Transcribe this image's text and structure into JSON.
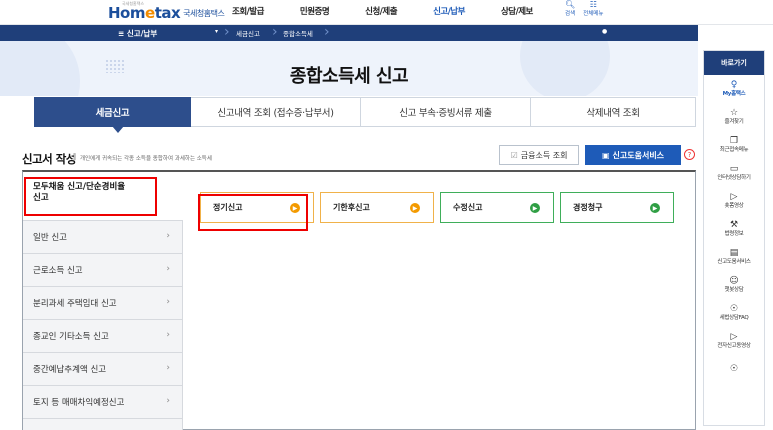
{
  "header": {
    "logo_small": "국세청홈택스",
    "logo_brand_prefix": "Hom",
    "logo_brand_e": "e",
    "logo_brand_suffix": "tax",
    "logo_nts": "국세청홈택스",
    "nav": [
      "조회/발급",
      "민원증명",
      "신청/제출",
      "신고/납부",
      "상담/제보"
    ],
    "active_nav": "신고/납부",
    "util": [
      {
        "icon": "search-icon",
        "label": "검색"
      },
      {
        "icon": "grid-menu-icon",
        "label": "전체메뉴"
      }
    ]
  },
  "subnav": {
    "menu_title": "≡  신고/납부",
    "crumb1": "세금신고",
    "crumb2": "종합소득세"
  },
  "hero": {
    "title": "종합소득세 신고"
  },
  "tabs": [
    "세금신고",
    "신고내역 조회 (접수증·납부서)",
    "신고 부속·증빙서류 제출",
    "삭제내역 조회"
  ],
  "section": {
    "title": "신고서 작성",
    "desc": "개인에게 귀속되는 각종 소득을 종합하여 과세하는 소득세",
    "btn_financial": "금융소득 조회",
    "btn_help": "신고도움서비스",
    "help_mark": "?"
  },
  "left_menu": [
    {
      "label": "모두채움 신고/단순경비율\n신고",
      "active": true
    },
    {
      "label": "일반 신고"
    },
    {
      "label": "근로소득 신고"
    },
    {
      "label": "분리과세 주택임대 신고"
    },
    {
      "label": "종교인 기타소득 신고"
    },
    {
      "label": "중간예납추계액 신고"
    },
    {
      "label": "토지 등 매매차익예정신고"
    }
  ],
  "cards": [
    {
      "label": "정기신고",
      "color": "orange"
    },
    {
      "label": "기한후신고",
      "color": "orange"
    },
    {
      "label": "수정신고",
      "color": "green"
    },
    {
      "label": "경정청구",
      "color": "green"
    }
  ],
  "right_bar": {
    "title": "바로가기",
    "items": [
      {
        "icon": "user-icon",
        "label": "My홈택스"
      },
      {
        "icon": "star-icon",
        "label": "즐겨찾기"
      },
      {
        "icon": "recent-menu-icon",
        "label": "최근접속메뉴"
      },
      {
        "icon": "monitor-icon",
        "label": "인터넷상담하기"
      },
      {
        "icon": "video-icon",
        "label": "숏폼영상"
      },
      {
        "icon": "gavel-icon",
        "label": "법령정보"
      },
      {
        "icon": "book-icon",
        "label": "신고도움서비스"
      },
      {
        "icon": "chatbot-icon",
        "label": "챗봇상담"
      },
      {
        "icon": "faq-icon",
        "label": "세법상담FAQ"
      },
      {
        "icon": "play-icon",
        "label": "전자신고동영상"
      },
      {
        "icon": "more-icon",
        "label": ""
      }
    ]
  }
}
